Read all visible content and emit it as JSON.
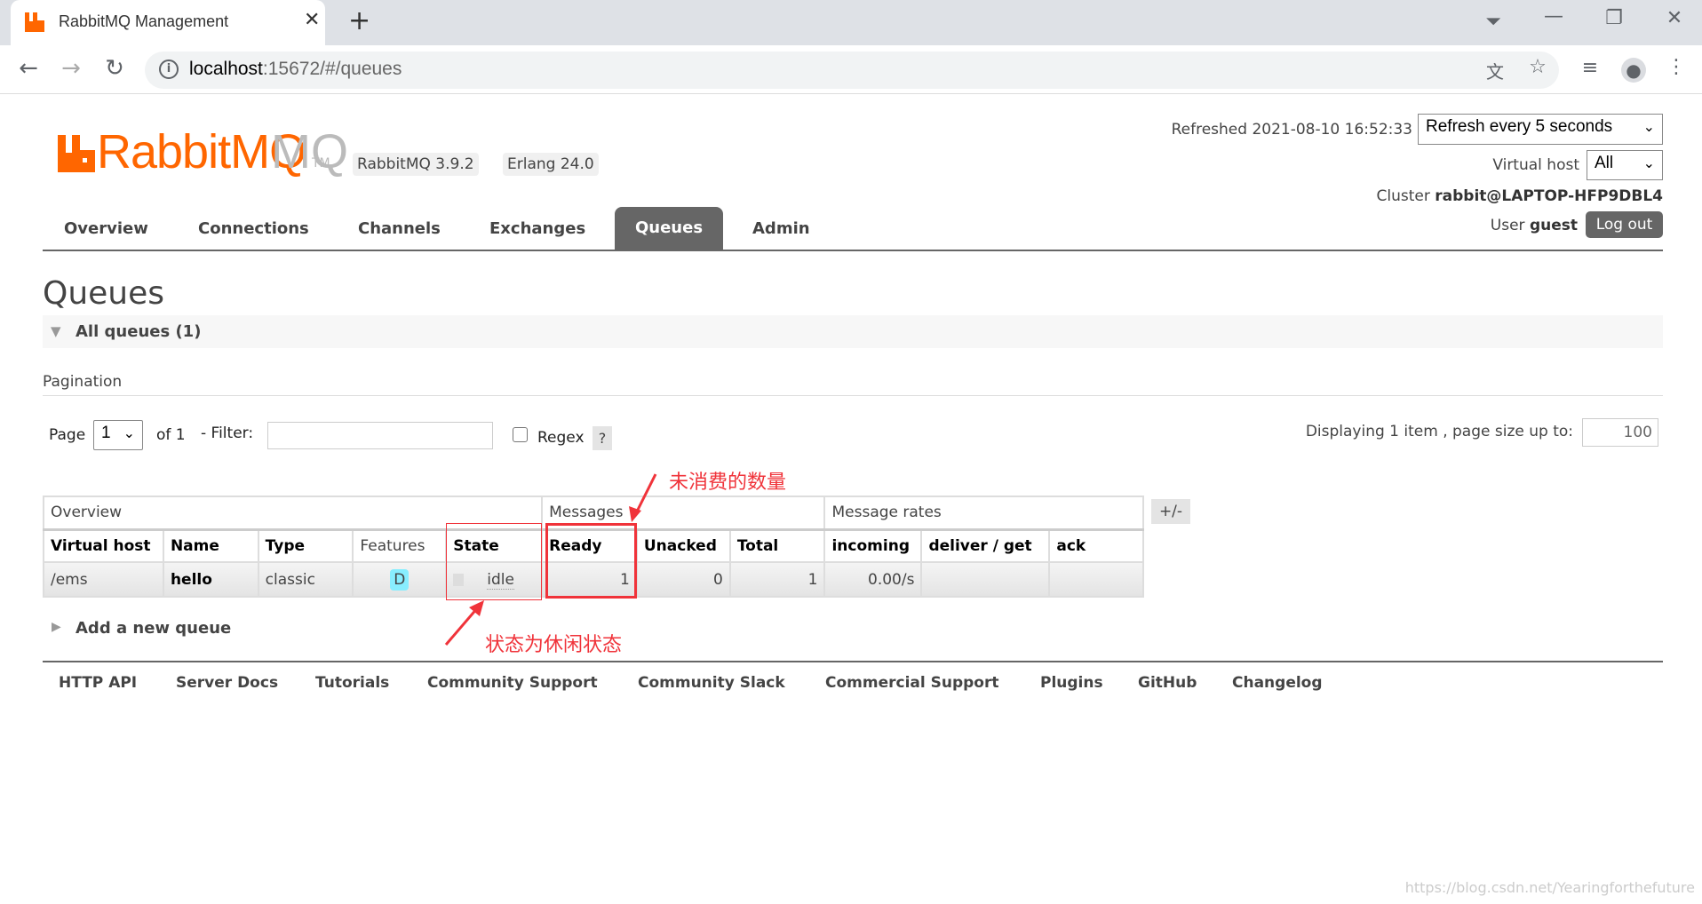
{
  "browser": {
    "tab_title": "RabbitMQ Management",
    "url_host": "localhost",
    "url_rest": ":15672/#/queues"
  },
  "header": {
    "logo_text": "RabbitMQ",
    "logo_tm": "TM",
    "version": "RabbitMQ 3.9.2",
    "erlang": "Erlang 24.0",
    "refreshed": "Refreshed 2021-08-10 16:52:33",
    "refresh_select": "Refresh every 5 seconds",
    "vhost_label": "Virtual host",
    "vhost_select": "All",
    "cluster_label": "Cluster",
    "cluster_name": "rabbit@LAPTOP-HFP9DBL4",
    "user_label": "User",
    "user_name": "guest",
    "logout": "Log out",
    "accent": "#ff6600"
  },
  "nav": [
    {
      "label": "Overview"
    },
    {
      "label": "Connections"
    },
    {
      "label": "Channels"
    },
    {
      "label": "Exchanges"
    },
    {
      "label": "Queues",
      "active": true
    },
    {
      "label": "Admin"
    }
  ],
  "main": {
    "title": "Queues",
    "section": "All queues (1)",
    "pagination_label": "Pagination",
    "page_label": "Page",
    "page_value": "1",
    "of_label": "of 1",
    "filter_label": "- Filter:",
    "filter_value": "",
    "regex_label": "Regex",
    "help": "?",
    "displaying": "Displaying 1 item , page size up to:",
    "page_size": "100",
    "add_queue": "Add a new queue",
    "toggle_columns": "+/-"
  },
  "table": {
    "groups": [
      "Overview",
      "Messages",
      "Message rates"
    ],
    "columns": [
      "Virtual host",
      "Name",
      "Type",
      "Features",
      "State",
      "Ready",
      "Unacked",
      "Total",
      "incoming",
      "deliver / get",
      "ack"
    ],
    "rows": [
      {
        "vhost": "/ems",
        "name": "hello",
        "type": "classic",
        "features": "D",
        "state": "idle",
        "ready": "1",
        "unacked": "0",
        "total": "1",
        "incoming": "0.00/s",
        "deliver_get": "",
        "ack": ""
      }
    ]
  },
  "annotations": {
    "ready": "未消费的数量",
    "state": "状态为休闲状态",
    "color": "#f0333a"
  },
  "footer": [
    {
      "label": "HTTP API"
    },
    {
      "label": "Server Docs"
    },
    {
      "label": "Tutorials"
    },
    {
      "label": "Community Support"
    },
    {
      "label": "Community Slack"
    },
    {
      "label": "Commercial Support"
    },
    {
      "label": "Plugins"
    },
    {
      "label": "GitHub"
    },
    {
      "label": "Changelog"
    }
  ],
  "watermark": "https://blog.csdn.net/Yearingforthefuture"
}
